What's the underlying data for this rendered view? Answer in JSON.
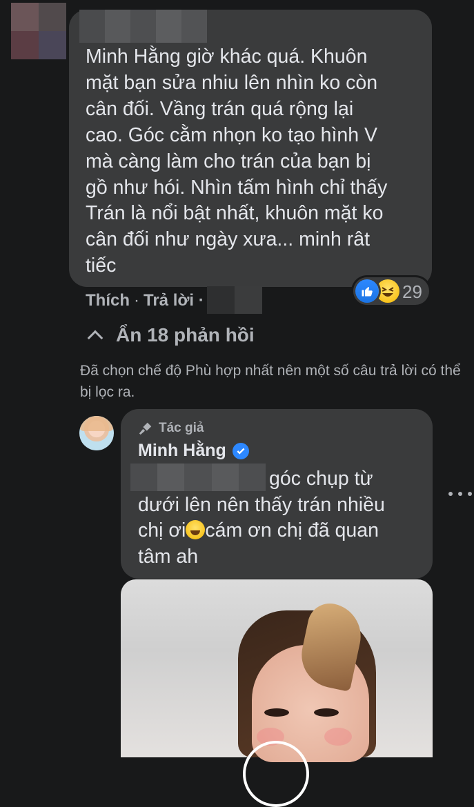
{
  "top_comment": {
    "text": "Minh Hằng giờ khác quá. Khuôn\nmặt bạn sửa nhiu lên nhìn ko còn\ncân đối. Vầng trán quá rộng lại\ncao. Góc cằm nhọn ko tạo hình V\nmà càng làm cho trán của bạn bị\ngồ như hói. Nhìn tấm hình chỉ thấy\nTrán là nổi bật nhất, khuôn mặt ko\ncân đối như ngày xưa... minh rât\ntiếc",
    "reactions": {
      "icons": [
        "like-icon",
        "haha-icon"
      ],
      "count": "29"
    },
    "actions": {
      "like": "Thích",
      "separator": "·",
      "reply": "Trả lời ·"
    }
  },
  "hide_replies": {
    "label": "Ẩn 18 phản hồi",
    "icon": "chevron-up-icon"
  },
  "filter_note": "Đã chọn chế độ Phù hợp nhất nên một số câu trả lời có thể bị lọc ra.",
  "reply": {
    "badge": "Tác giả",
    "badge_icon": "microphone-icon",
    "author": "Minh Hằng",
    "verified_icon": "verified-badge-icon",
    "line1": "góc chụp từ",
    "line2": "dưới lên nên thấy trán nhiều",
    "line3a": "chị ơi",
    "line3b": "cám ơn chị đã quan",
    "line4": "tâm ah",
    "emoji": "tired-face-emoji-icon",
    "more_icon": "more-options-icon"
  },
  "colors": {
    "background": "#18191a",
    "bubble": "#3a3b3c",
    "primary_text": "#e4e6eb",
    "secondary_text": "#b0b3b8",
    "accent_blue": "#2d88ff"
  }
}
